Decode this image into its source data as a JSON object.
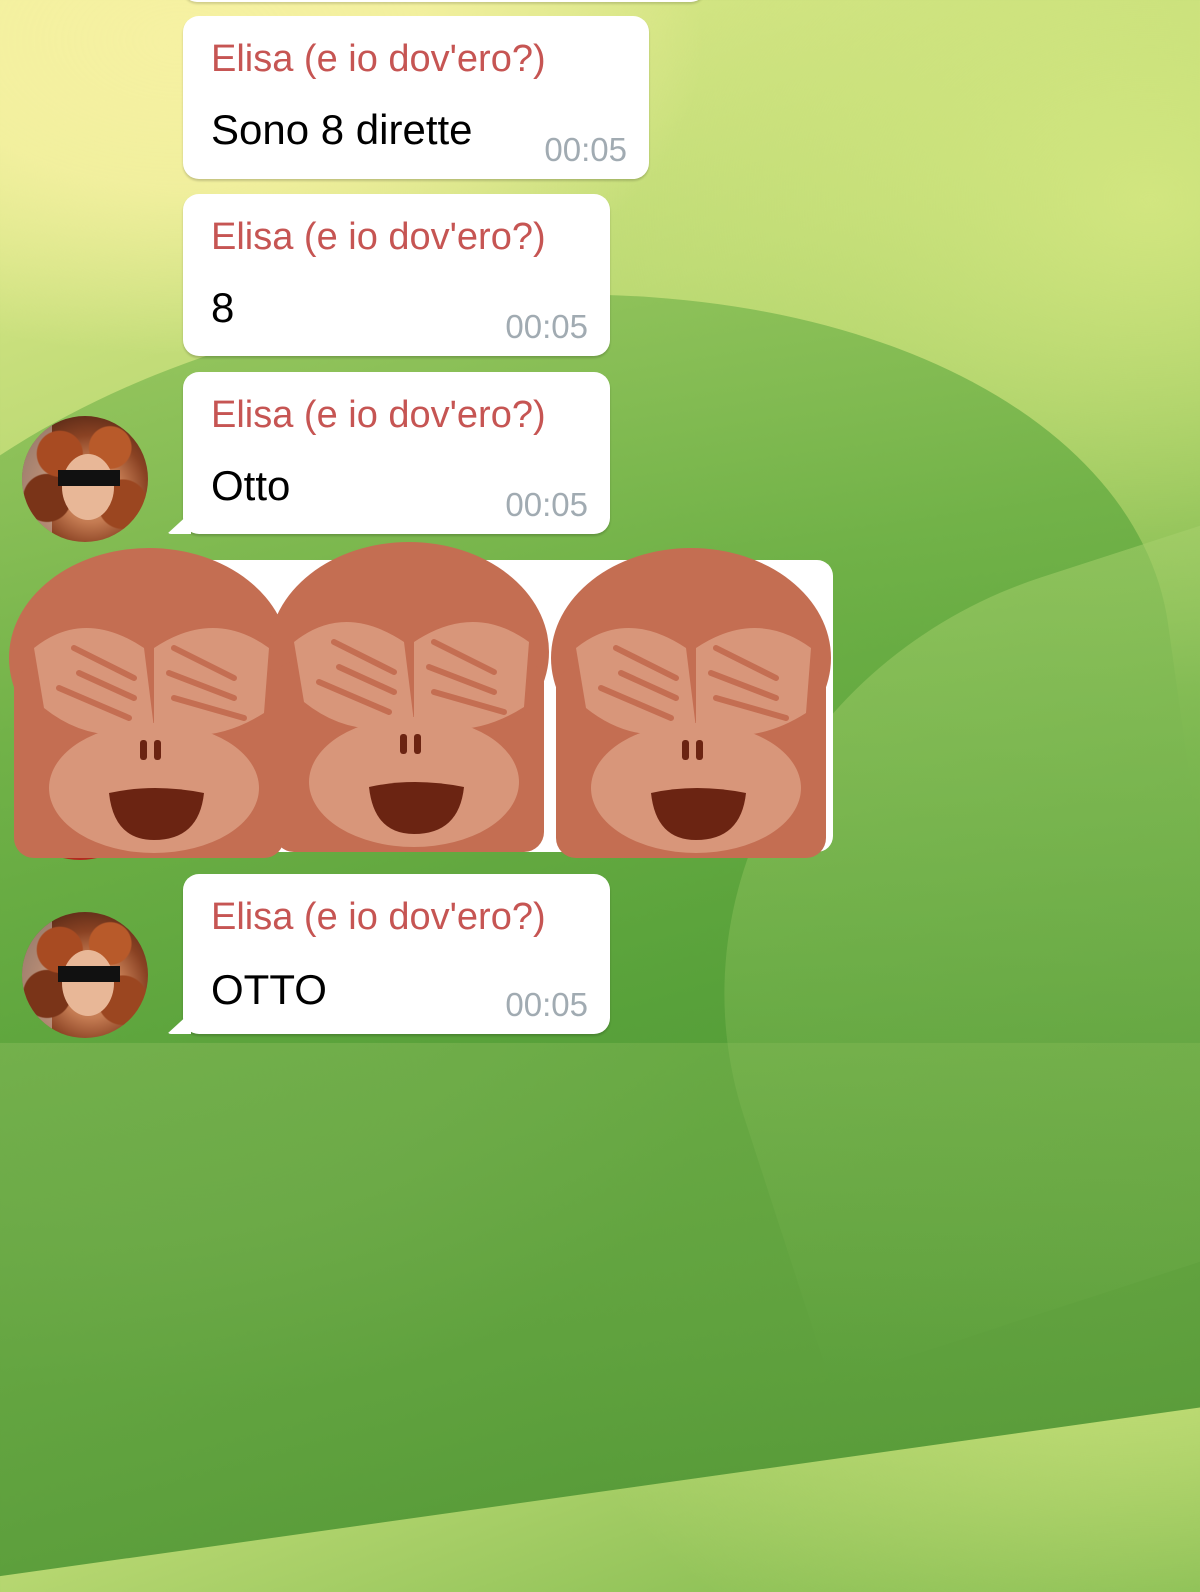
{
  "chat": {
    "messages": [
      {
        "sender": "Elisa (e io dov'ero?)",
        "text": "Sono 8 dirette",
        "time": "00:05"
      },
      {
        "sender": "Elisa (e io dov'ero?)",
        "text": "8",
        "time": "00:05"
      },
      {
        "sender": "Elisa (e io dov'ero?)",
        "text": "Otto",
        "time": "00:05"
      },
      {
        "sender": "Elisa (e io dov'ero?)",
        "text": "OTTO",
        "time": "00:05"
      }
    ],
    "sticker": {
      "emoji": "see-no-evil-monkey",
      "count": 3
    }
  },
  "colors": {
    "sender": "#c65553",
    "time": "#a1abb2",
    "monkey_fur": "#c46e52",
    "monkey_skin": "#d8967a",
    "monkey_mouth": "#6b2412"
  }
}
